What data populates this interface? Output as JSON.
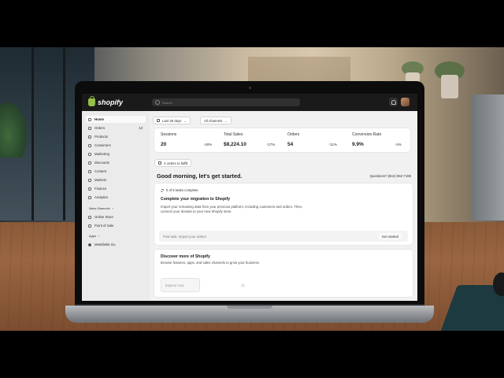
{
  "topbar": {
    "logo_text": "shopify",
    "search_placeholder": "Search"
  },
  "sidebar": {
    "items": [
      {
        "label": "Home",
        "icon": "home-icon",
        "active": true
      },
      {
        "label": "Orders",
        "icon": "orders-icon",
        "count": "13"
      },
      {
        "label": "Products",
        "icon": "products-icon"
      },
      {
        "label": "Customers",
        "icon": "customers-icon"
      },
      {
        "label": "Marketing",
        "icon": "marketing-icon"
      },
      {
        "label": "Discounts",
        "icon": "discounts-icon"
      },
      {
        "label": "Content",
        "icon": "content-icon"
      },
      {
        "label": "Markets",
        "icon": "markets-icon"
      },
      {
        "label": "Finance",
        "icon": "finance-icon"
      },
      {
        "label": "Analytics",
        "icon": "analytics-icon"
      }
    ],
    "sales_channels_heading": "Sales Channels",
    "sales_channels": [
      {
        "label": "Online Store",
        "icon": "online-store-icon"
      },
      {
        "label": "Point of Sale",
        "icon": "point-of-sale-icon"
      }
    ],
    "apps_heading": "Apps",
    "apps": [
      {
        "label": "Metafields Gu",
        "icon": "app-icon"
      }
    ]
  },
  "filters": {
    "date_range": "Last 30 days",
    "channels": "All channels"
  },
  "metrics": [
    {
      "label": "Sessions",
      "value": "20",
      "delta": "40%"
    },
    {
      "label": "Total Sales",
      "value": "$8,224.10",
      "delta": "17%"
    },
    {
      "label": "Orders",
      "value": "54",
      "delta": "11%"
    },
    {
      "label": "Conversion Rate",
      "value": "9.9%",
      "delta": "4%"
    }
  ],
  "orders_to_fulfill": "4 orders to fulfill",
  "greeting": "Good morning, let's get started.",
  "questions": "Questions? (844) 962-7186",
  "setup": {
    "progress": "0 of 5 tasks complete",
    "title": "Complete your migration to Shopify",
    "description": "Import your remaining data from your previous platform, including customers and orders. Then, connect your domain to your new Shopify store.",
    "task_text": "First task: Import your orders",
    "task_button": "Get started"
  },
  "discover": {
    "title": "Discover more of Shopify",
    "description": "Browse features, apps, and sales channels to grow your business",
    "button": "Explore now"
  },
  "colors": {
    "topbar": "#1a1a1a",
    "brand_green": "#95bf47",
    "sidebar_bg": "#ebebeb",
    "content_bg": "#f1f1f1"
  }
}
